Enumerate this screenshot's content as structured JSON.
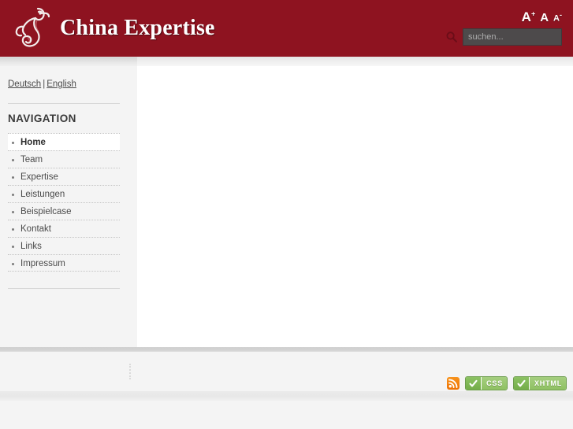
{
  "header": {
    "site_title": "China Expertise",
    "logo_icon": "dragon-logo-icon",
    "background_color": "#8e1320",
    "fontsize": {
      "increase_label": "A",
      "increase_sup": "+",
      "normal_label": "A",
      "decrease_label": "A",
      "decrease_sup": "-"
    },
    "search": {
      "icon": "search-icon",
      "placeholder": "suchen...",
      "value": ""
    }
  },
  "sidebar": {
    "languages": {
      "german_label": "Deutsch",
      "separator": "|",
      "english_label": "English"
    },
    "nav_title": "NAVIGATION",
    "items": [
      {
        "label": "Home",
        "active": true
      },
      {
        "label": "Team",
        "active": false
      },
      {
        "label": "Expertise",
        "active": false
      },
      {
        "label": "Leistungen",
        "active": false
      },
      {
        "label": "Beispielcase",
        "active": false
      },
      {
        "label": "Kontakt",
        "active": false
      },
      {
        "label": "Links",
        "active": false
      },
      {
        "label": "Impressum",
        "active": false
      }
    ]
  },
  "content": {
    "body_text": ""
  },
  "footer": {
    "rss_icon": "rss-icon",
    "badges": [
      {
        "icon": "check-icon",
        "label": "CSS"
      },
      {
        "icon": "check-icon",
        "label": "XHTML"
      }
    ]
  },
  "colors": {
    "brand_red": "#8e1320",
    "page_grey": "#f4f4f4",
    "badge_green": "#8fc163",
    "rss_orange": "#ee7203"
  }
}
